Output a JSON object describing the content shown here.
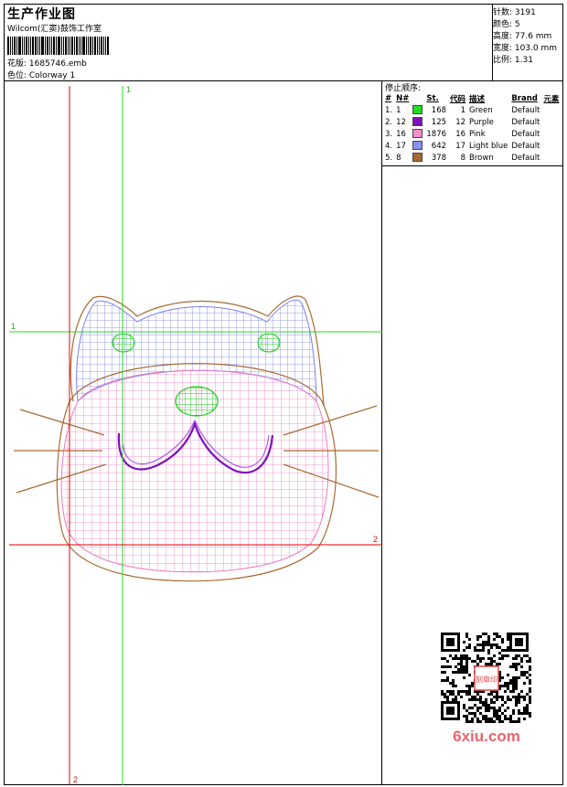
{
  "header": {
    "title": "生产作业图",
    "company": "Wilcom(汇窦)鼓饰工作室",
    "design_label": "花版: 1685746.emb",
    "colorway_label": "色位: Colorway 1"
  },
  "stats": {
    "stitches": "针数: 3191",
    "colors": "颜色: 5",
    "height": "高度: 77.6 mm",
    "width": "宽度: 103.0 mm",
    "scale": "比例: 1.31"
  },
  "stop_sequence": {
    "title": "停止顺序:",
    "headers": [
      "#",
      "N#",
      "",
      "St.",
      "代码",
      "描述",
      "Brand",
      "元素"
    ],
    "rows": [
      {
        "idx": "1.",
        "n": "1",
        "color": "#22dd22",
        "st": "168",
        "code": "1",
        "desc": "Green",
        "brand": "Default"
      },
      {
        "idx": "2.",
        "n": "12",
        "color": "#7b11b8",
        "st": "125",
        "code": "12",
        "desc": "Purple",
        "brand": "Default"
      },
      {
        "idx": "3.",
        "n": "16",
        "color": "#f48fc8",
        "st": "1876",
        "code": "16",
        "desc": "Pink",
        "brand": "Default"
      },
      {
        "idx": "4.",
        "n": "17",
        "color": "#8a8ff0",
        "st": "642",
        "code": "17",
        "desc": "Light blue",
        "brand": "Default"
      },
      {
        "idx": "5.",
        "n": "8",
        "color": "#a86a32",
        "st": "378",
        "code": "8",
        "desc": "Brown",
        "brand": "Default"
      }
    ]
  },
  "guides": {
    "green_v": "1",
    "green_h": "1",
    "red_v": "2",
    "red_h": "2"
  },
  "watermark": "6xiu.com",
  "seal": "刻章印",
  "colors": {
    "green": "#22dd22",
    "purple": "#7b11b8",
    "pink": "#f48fc8",
    "light_blue": "#8a8ff0",
    "brown": "#a86a32",
    "guide_green": "#22dd22",
    "guide_red": "#e00000"
  }
}
